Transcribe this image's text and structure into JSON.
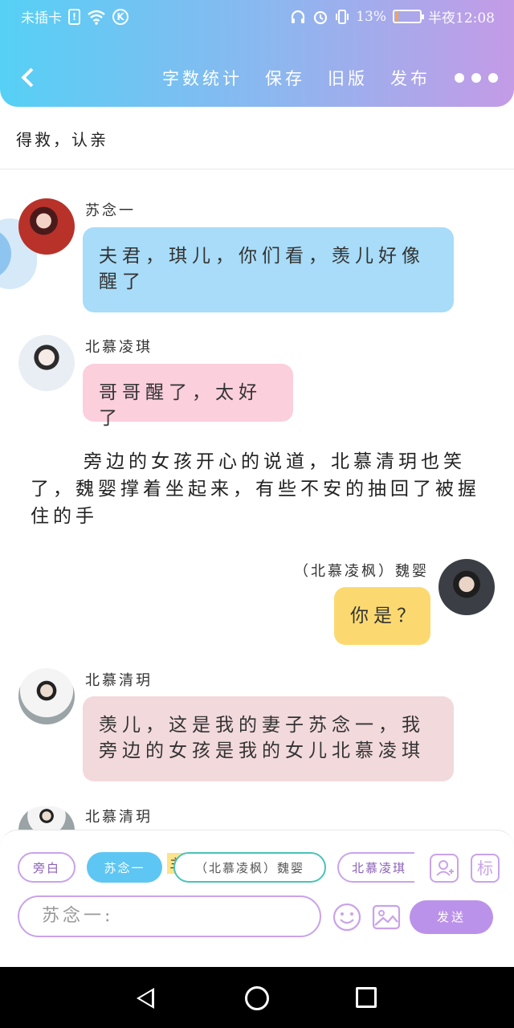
{
  "status_bar": {
    "carrier": "未插卡",
    "battery_percent": "13%",
    "time": "半夜12:08"
  },
  "header": {
    "menu": [
      "字数统计",
      "保存",
      "旧版",
      "发布"
    ]
  },
  "chapter_title": "得救，认亲",
  "messages": [
    {
      "speaker": "苏念一",
      "text": "夫君，琪儿，你们看，羡儿好像醒了",
      "bubble_color": "#a8dcf8"
    },
    {
      "speaker": "北慕凌琪",
      "text": "哥哥醒了，太好了",
      "bubble_color": "#fbcfdc"
    },
    {
      "narration": "旁边的女孩开心的说道，北慕清玥也笑了，魏婴撑着坐起来，有些不安的抽回了被握住的手"
    },
    {
      "speaker": "（北慕凌枫）魏婴",
      "text": "你是？",
      "bubble_color": "#fcd970"
    },
    {
      "speaker": "北慕清玥",
      "text": "羡儿，这是我的妻子苏念一，我旁边的女孩是我的女儿北慕凌琪",
      "bubble_color": "#f2d9dc"
    },
    {
      "speaker": "北慕清玥",
      "text": ""
    }
  ],
  "composer": {
    "roles": [
      "旁白",
      "苏念一",
      "（北慕凌枫）魏婴",
      "北慕凌琪"
    ],
    "main_tag": "主",
    "tag_icon_label": "标",
    "input_value": "苏念一:",
    "send_label": "发送"
  }
}
